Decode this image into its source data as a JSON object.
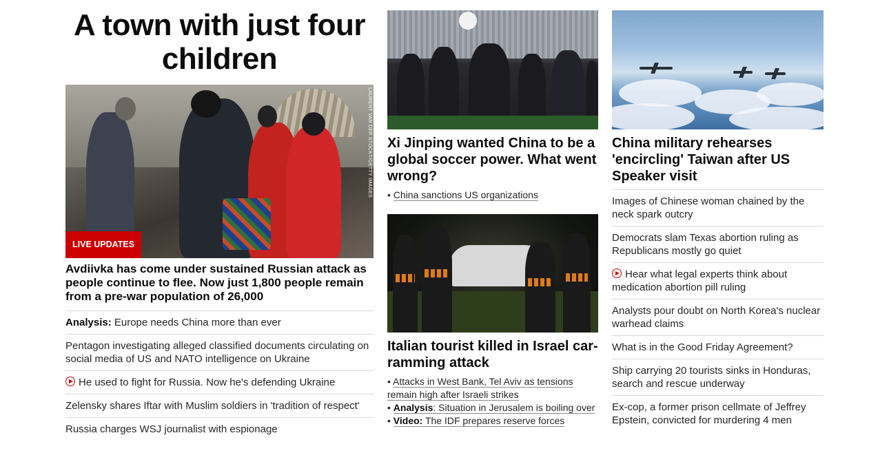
{
  "left": {
    "title": "A town with just four children",
    "image_credit": "LAURENT VAN DER STOCKT/GETTY IMAGES",
    "badge": "LIVE UPDATES",
    "headline": "Avdiivka has come under sustained Russian attack as people continue to flee. Now just 1,800 people remain from a pre-war population of 26,000",
    "links": [
      {
        "prefix": "Analysis:",
        "text": " Europe needs China more than ever",
        "video": false
      },
      {
        "prefix": "",
        "text": "Pentagon investigating alleged classified documents circulating on social media of US and NATO intelligence on Ukraine",
        "video": false
      },
      {
        "prefix": "",
        "text": "He used to fight for Russia. Now he's defending Ukraine",
        "video": true
      },
      {
        "prefix": "",
        "text": "Zelensky shares Iftar with Muslim soldiers in 'tradition of respect'",
        "video": false
      },
      {
        "prefix": "",
        "text": "Russia charges WSJ journalist with espionage",
        "video": false
      }
    ]
  },
  "middle": {
    "story1": {
      "headline": "Xi Jinping wanted China to be a global soccer power. What went wrong?",
      "links": [
        {
          "prefix": "",
          "text": "China sanctions US organizations"
        }
      ]
    },
    "story2": {
      "headline": "Italian tourist killed in Israel car-ramming attack",
      "links": [
        {
          "prefix": "",
          "text": "Attacks in West Bank, Tel Aviv as tensions remain high after Israeli strikes"
        },
        {
          "prefix": "Analysis",
          "text": ": Situation in Jerusalem is boiling over"
        },
        {
          "prefix": "Video:",
          "text": " The IDF prepares reserve forces"
        }
      ]
    }
  },
  "right": {
    "headline": "China military rehearses 'encircling' Taiwan after US Speaker visit",
    "links": [
      {
        "text": "Images of Chinese woman chained by the neck spark outcry",
        "video": false
      },
      {
        "text": "Democrats slam Texas abortion ruling as Republicans mostly go quiet",
        "video": false
      },
      {
        "text": "Hear what legal experts think about medication abortion pill ruling",
        "video": true
      },
      {
        "text": "Analysts pour doubt on North Korea's nuclear warhead claims",
        "video": false
      },
      {
        "text": "What is in the Good Friday Agreement?",
        "video": false
      },
      {
        "text": "Ship carrying 20 tourists sinks in Honduras, search and rescue underway",
        "video": false
      },
      {
        "text": "Ex-cop, a former prison cellmate of Jeffrey Epstein, convicted for murdering 4 men",
        "video": false
      }
    ]
  },
  "colors": {
    "accent": "#cc0000",
    "text": "#0c0c0c",
    "divider": "#d9d9d9"
  }
}
